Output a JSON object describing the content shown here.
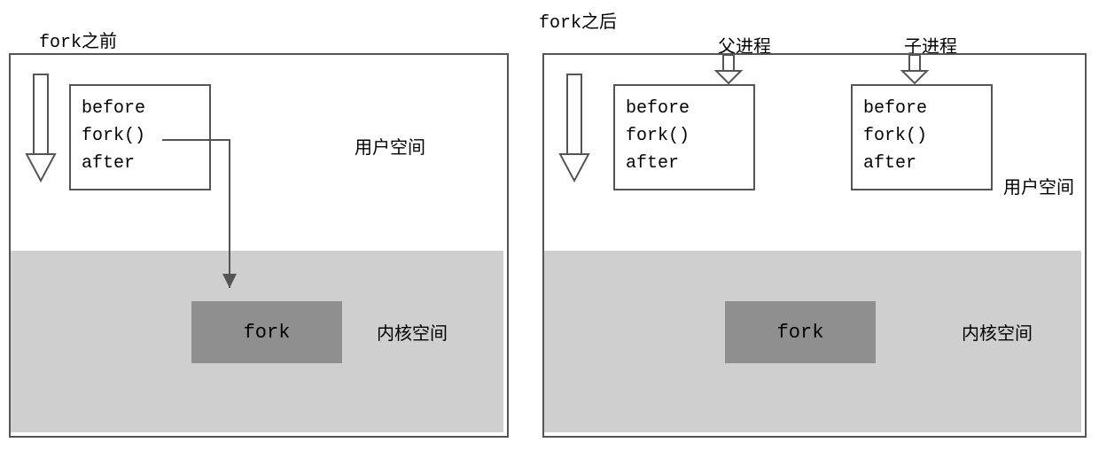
{
  "titles": {
    "before_fork": "fork之前",
    "after_fork": "fork之后",
    "parent_proc": "父进程",
    "child_proc": "子进程"
  },
  "space_labels": {
    "user": "用户空间",
    "kernel": "内核空间"
  },
  "code_lines": {
    "before": "before",
    "fork": "fork()",
    "after": "after"
  },
  "kernel_call": "fork",
  "colors": {
    "panel_border": "#555555",
    "kernel_bg": "#cfcfcf",
    "fork_bg": "#8f8f8f",
    "arrow_stroke": "#555555"
  }
}
